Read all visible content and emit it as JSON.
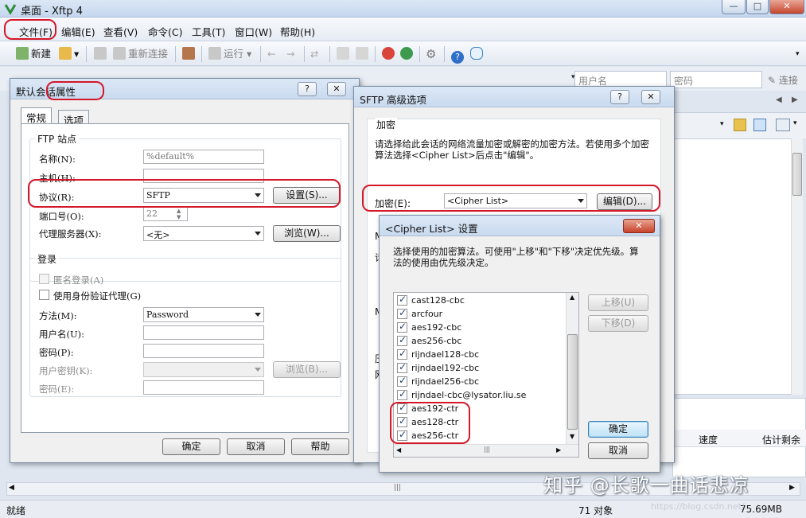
{
  "window": {
    "title": "桌面 - Xftp 4"
  },
  "menu": [
    "文件(F)",
    "编辑(E)",
    "查看(V)",
    "命令(C)",
    "工具(T)",
    "窗口(W)",
    "帮助(H)"
  ],
  "toolbar": {
    "new_label": "新建",
    "reconnect_label": "重新连接",
    "run_label": "运行"
  },
  "addressbar": {
    "username_placeholder": "用户名",
    "password_placeholder": "密码",
    "connect_label": "连接"
  },
  "right_pane": {
    "col_speed": "速度",
    "col_remaining": "估计剩余"
  },
  "status": {
    "ready": "就绪",
    "objects": "71 对象",
    "size": "75.69MB"
  },
  "watermark": "知乎 @长歌一曲话悲凉",
  "watermark_url": "https://blog.csdn.net/...",
  "session_dialog": {
    "title": "默认会话属性",
    "tabs": [
      "常规",
      "选项"
    ],
    "ftp_group": "FTP 站点",
    "name_label": "名称(N):",
    "name_value": "%default%",
    "host_label": "主机(H):",
    "host_value": "",
    "protocol_label": "协议(R):",
    "protocol_value": "SFTP",
    "settings_button": "设置(S)...",
    "port_label": "端口号(O):",
    "port_value": "22",
    "proxy_label": "代理服务器(X):",
    "proxy_value": "<无>",
    "browse_button": "浏览(W)...",
    "login_group": "登录",
    "anonymous_label": "匿名登录(A)",
    "agent_label": "使用身份验证代理(G)",
    "method_label": "方法(M):",
    "method_value": "Password",
    "username_label": "用户名(U):",
    "password_label": "密码(P):",
    "userkey_label": "用户密钥(K):",
    "userkey_browse": "浏览(B)...",
    "passphrase_label": "密码(E):",
    "ok": "确定",
    "cancel": "取消",
    "help": "帮助"
  },
  "sftp_dialog": {
    "title": "SFTP 高级选项",
    "group": "加密",
    "description": "请选择给此会话的网络流量加密或解密的加密方法。若使用多个加密算法选择<Cipher List>后点击\"编辑\"。",
    "cipher_label": "加密(E):",
    "cipher_value": "<Cipher List>",
    "edit_button": "编辑(D)..."
  },
  "cipher_dialog": {
    "title": "<Cipher List> 设置",
    "description": "选择使用的加密算法。可使用\"上移\"和\"下移\"决定优先级。算法的使用由优先级决定。",
    "items": [
      {
        "name": "cast128-cbc",
        "checked": true
      },
      {
        "name": "arcfour",
        "checked": true
      },
      {
        "name": "aes192-cbc",
        "checked": true
      },
      {
        "name": "aes256-cbc",
        "checked": true
      },
      {
        "name": "rijndael128-cbc",
        "checked": true
      },
      {
        "name": "rijndael192-cbc",
        "checked": true
      },
      {
        "name": "rijndael256-cbc",
        "checked": true
      },
      {
        "name": "rijndael-cbc@lysator.liu.se",
        "checked": true
      },
      {
        "name": "aes192-ctr",
        "checked": true
      },
      {
        "name": "aes128-ctr",
        "checked": true
      },
      {
        "name": "aes256-ctr",
        "checked": true
      }
    ],
    "move_up": "上移(U)",
    "move_down": "下移(D)",
    "ok": "确定",
    "cancel": "取消"
  },
  "colors": {
    "highlight": "#d4182a",
    "title_gradient": "#c9daef",
    "dialog_bg": "#f0f0f0"
  }
}
